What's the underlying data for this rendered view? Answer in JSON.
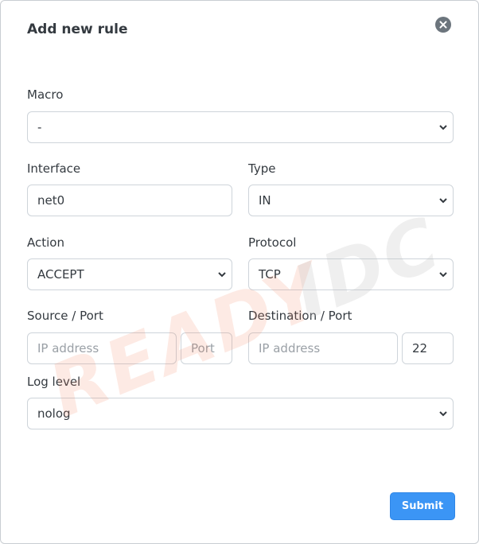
{
  "dialog": {
    "title": "Add new rule",
    "close_icon": "close-circle-icon"
  },
  "form": {
    "macro": {
      "label": "Macro",
      "value": "-"
    },
    "interface": {
      "label": "Interface",
      "value": "net0"
    },
    "type": {
      "label": "Type",
      "value": "IN"
    },
    "action": {
      "label": "Action",
      "value": "ACCEPT"
    },
    "protocol": {
      "label": "Protocol",
      "value": "TCP"
    },
    "source": {
      "label": "Source / Port",
      "ip_placeholder": "IP address",
      "port_placeholder": "Port"
    },
    "destination": {
      "label": "Destination / Port",
      "ip_placeholder": "IP address",
      "port_value": "22"
    },
    "log_level": {
      "label": "Log level",
      "value": "nolog"
    }
  },
  "submit_label": "Submit",
  "watermark": {
    "text": "READYIDC",
    "colors": [
      "#f07a5a",
      "#d9d9d9"
    ]
  },
  "colors": {
    "primary": "#3b95f5",
    "border": "#ced4da",
    "text": "#343a40"
  }
}
